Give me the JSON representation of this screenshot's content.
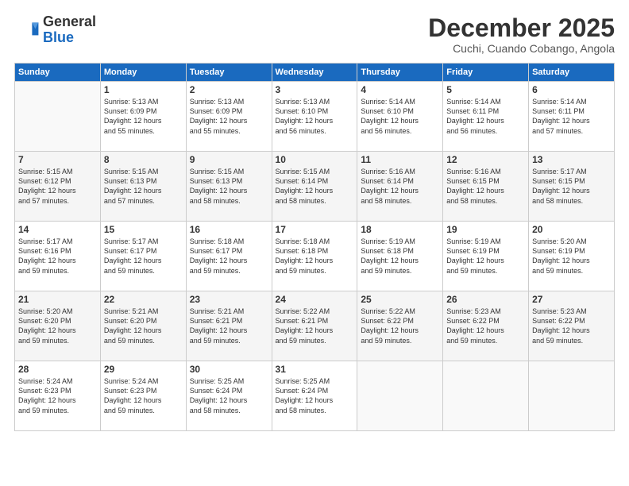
{
  "logo": {
    "general": "General",
    "blue": "Blue"
  },
  "header": {
    "month_title": "December 2025",
    "subtitle": "Cuchi, Cuando Cobango, Angola"
  },
  "weekdays": [
    "Sunday",
    "Monday",
    "Tuesday",
    "Wednesday",
    "Thursday",
    "Friday",
    "Saturday"
  ],
  "weeks": [
    [
      {
        "day": "",
        "info": ""
      },
      {
        "day": "1",
        "info": "Sunrise: 5:13 AM\nSunset: 6:09 PM\nDaylight: 12 hours\nand 55 minutes."
      },
      {
        "day": "2",
        "info": "Sunrise: 5:13 AM\nSunset: 6:09 PM\nDaylight: 12 hours\nand 55 minutes."
      },
      {
        "day": "3",
        "info": "Sunrise: 5:13 AM\nSunset: 6:10 PM\nDaylight: 12 hours\nand 56 minutes."
      },
      {
        "day": "4",
        "info": "Sunrise: 5:14 AM\nSunset: 6:10 PM\nDaylight: 12 hours\nand 56 minutes."
      },
      {
        "day": "5",
        "info": "Sunrise: 5:14 AM\nSunset: 6:11 PM\nDaylight: 12 hours\nand 56 minutes."
      },
      {
        "day": "6",
        "info": "Sunrise: 5:14 AM\nSunset: 6:11 PM\nDaylight: 12 hours\nand 57 minutes."
      }
    ],
    [
      {
        "day": "7",
        "info": "Sunrise: 5:15 AM\nSunset: 6:12 PM\nDaylight: 12 hours\nand 57 minutes."
      },
      {
        "day": "8",
        "info": "Sunrise: 5:15 AM\nSunset: 6:13 PM\nDaylight: 12 hours\nand 57 minutes."
      },
      {
        "day": "9",
        "info": "Sunrise: 5:15 AM\nSunset: 6:13 PM\nDaylight: 12 hours\nand 58 minutes."
      },
      {
        "day": "10",
        "info": "Sunrise: 5:15 AM\nSunset: 6:14 PM\nDaylight: 12 hours\nand 58 minutes."
      },
      {
        "day": "11",
        "info": "Sunrise: 5:16 AM\nSunset: 6:14 PM\nDaylight: 12 hours\nand 58 minutes."
      },
      {
        "day": "12",
        "info": "Sunrise: 5:16 AM\nSunset: 6:15 PM\nDaylight: 12 hours\nand 58 minutes."
      },
      {
        "day": "13",
        "info": "Sunrise: 5:17 AM\nSunset: 6:15 PM\nDaylight: 12 hours\nand 58 minutes."
      }
    ],
    [
      {
        "day": "14",
        "info": "Sunrise: 5:17 AM\nSunset: 6:16 PM\nDaylight: 12 hours\nand 59 minutes."
      },
      {
        "day": "15",
        "info": "Sunrise: 5:17 AM\nSunset: 6:17 PM\nDaylight: 12 hours\nand 59 minutes."
      },
      {
        "day": "16",
        "info": "Sunrise: 5:18 AM\nSunset: 6:17 PM\nDaylight: 12 hours\nand 59 minutes."
      },
      {
        "day": "17",
        "info": "Sunrise: 5:18 AM\nSunset: 6:18 PM\nDaylight: 12 hours\nand 59 minutes."
      },
      {
        "day": "18",
        "info": "Sunrise: 5:19 AM\nSunset: 6:18 PM\nDaylight: 12 hours\nand 59 minutes."
      },
      {
        "day": "19",
        "info": "Sunrise: 5:19 AM\nSunset: 6:19 PM\nDaylight: 12 hours\nand 59 minutes."
      },
      {
        "day": "20",
        "info": "Sunrise: 5:20 AM\nSunset: 6:19 PM\nDaylight: 12 hours\nand 59 minutes."
      }
    ],
    [
      {
        "day": "21",
        "info": "Sunrise: 5:20 AM\nSunset: 6:20 PM\nDaylight: 12 hours\nand 59 minutes."
      },
      {
        "day": "22",
        "info": "Sunrise: 5:21 AM\nSunset: 6:20 PM\nDaylight: 12 hours\nand 59 minutes."
      },
      {
        "day": "23",
        "info": "Sunrise: 5:21 AM\nSunset: 6:21 PM\nDaylight: 12 hours\nand 59 minutes."
      },
      {
        "day": "24",
        "info": "Sunrise: 5:22 AM\nSunset: 6:21 PM\nDaylight: 12 hours\nand 59 minutes."
      },
      {
        "day": "25",
        "info": "Sunrise: 5:22 AM\nSunset: 6:22 PM\nDaylight: 12 hours\nand 59 minutes."
      },
      {
        "day": "26",
        "info": "Sunrise: 5:23 AM\nSunset: 6:22 PM\nDaylight: 12 hours\nand 59 minutes."
      },
      {
        "day": "27",
        "info": "Sunrise: 5:23 AM\nSunset: 6:22 PM\nDaylight: 12 hours\nand 59 minutes."
      }
    ],
    [
      {
        "day": "28",
        "info": "Sunrise: 5:24 AM\nSunset: 6:23 PM\nDaylight: 12 hours\nand 59 minutes."
      },
      {
        "day": "29",
        "info": "Sunrise: 5:24 AM\nSunset: 6:23 PM\nDaylight: 12 hours\nand 59 minutes."
      },
      {
        "day": "30",
        "info": "Sunrise: 5:25 AM\nSunset: 6:24 PM\nDaylight: 12 hours\nand 58 minutes."
      },
      {
        "day": "31",
        "info": "Sunrise: 5:25 AM\nSunset: 6:24 PM\nDaylight: 12 hours\nand 58 minutes."
      },
      {
        "day": "",
        "info": ""
      },
      {
        "day": "",
        "info": ""
      },
      {
        "day": "",
        "info": ""
      }
    ]
  ]
}
